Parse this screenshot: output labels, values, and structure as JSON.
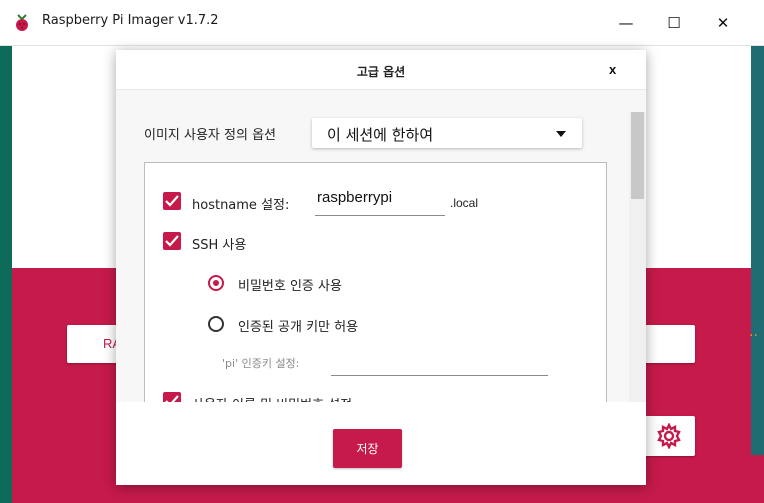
{
  "window": {
    "title": "Raspberry Pi Imager v1.7.2",
    "minimize": "—",
    "maximize": "☐",
    "close": "✕",
    "icon": "raspberry-pi-icon"
  },
  "background": {
    "left_button_label": "RA",
    "gear_icon": "gear-icon"
  },
  "dialog": {
    "title": "고급 옵션",
    "close_label": "x",
    "image_options_label": "이미지 사용자 정의 옵션",
    "image_options_value": "이 세션에 한하여",
    "hostname": {
      "checked": true,
      "label": "hostname 설정:",
      "value": "raspberrypi",
      "suffix": ".local"
    },
    "ssh": {
      "checked": true,
      "label": "SSH 사용",
      "password_auth_label": "비밀번호 인증 사용",
      "password_auth_selected": true,
      "pubkey_auth_label": "인증된 공개 키만 허용",
      "pubkey_auth_selected": false,
      "pubkey_field_label": "'pi' 인증키 설정:"
    },
    "user": {
      "checked": true,
      "label": "사용자 이름 및 비밀번호 설정"
    },
    "save_label": "저장"
  },
  "colors": {
    "accent": "#c51a4a",
    "teal": "#0e6b5a"
  }
}
